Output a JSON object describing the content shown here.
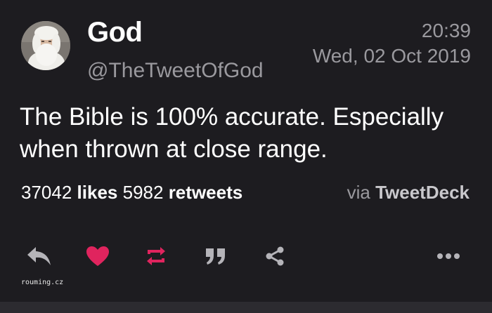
{
  "tweet": {
    "display_name": "God",
    "handle": "@TheTweetOfGod",
    "time": "20:39",
    "date": "Wed, 02 Oct 2019",
    "text": "The Bible is 100% accurate. Especially when thrown at close range.",
    "likes_count": "37042",
    "likes_label": "likes",
    "retweets_count": "5982",
    "retweets_label": "retweets",
    "via_prefix": "via",
    "via_client": "TweetDeck"
  },
  "actions": [
    {
      "icon": "reply-icon",
      "color": "#b5b4b9"
    },
    {
      "icon": "heart-icon",
      "color": "#e0245e"
    },
    {
      "icon": "retweet-icon",
      "color": "#e0245e"
    },
    {
      "icon": "quote-icon",
      "color": "#b5b4b9"
    },
    {
      "icon": "share-icon",
      "color": "#b5b4b9"
    },
    {
      "icon": "more-icon",
      "color": "#b5b4b9"
    }
  ],
  "watermark": "rouming.cz",
  "colors": {
    "background": "#1d1c20",
    "text": "#ffffff",
    "muted": "#9a999e",
    "accent_red": "#e0245e"
  }
}
